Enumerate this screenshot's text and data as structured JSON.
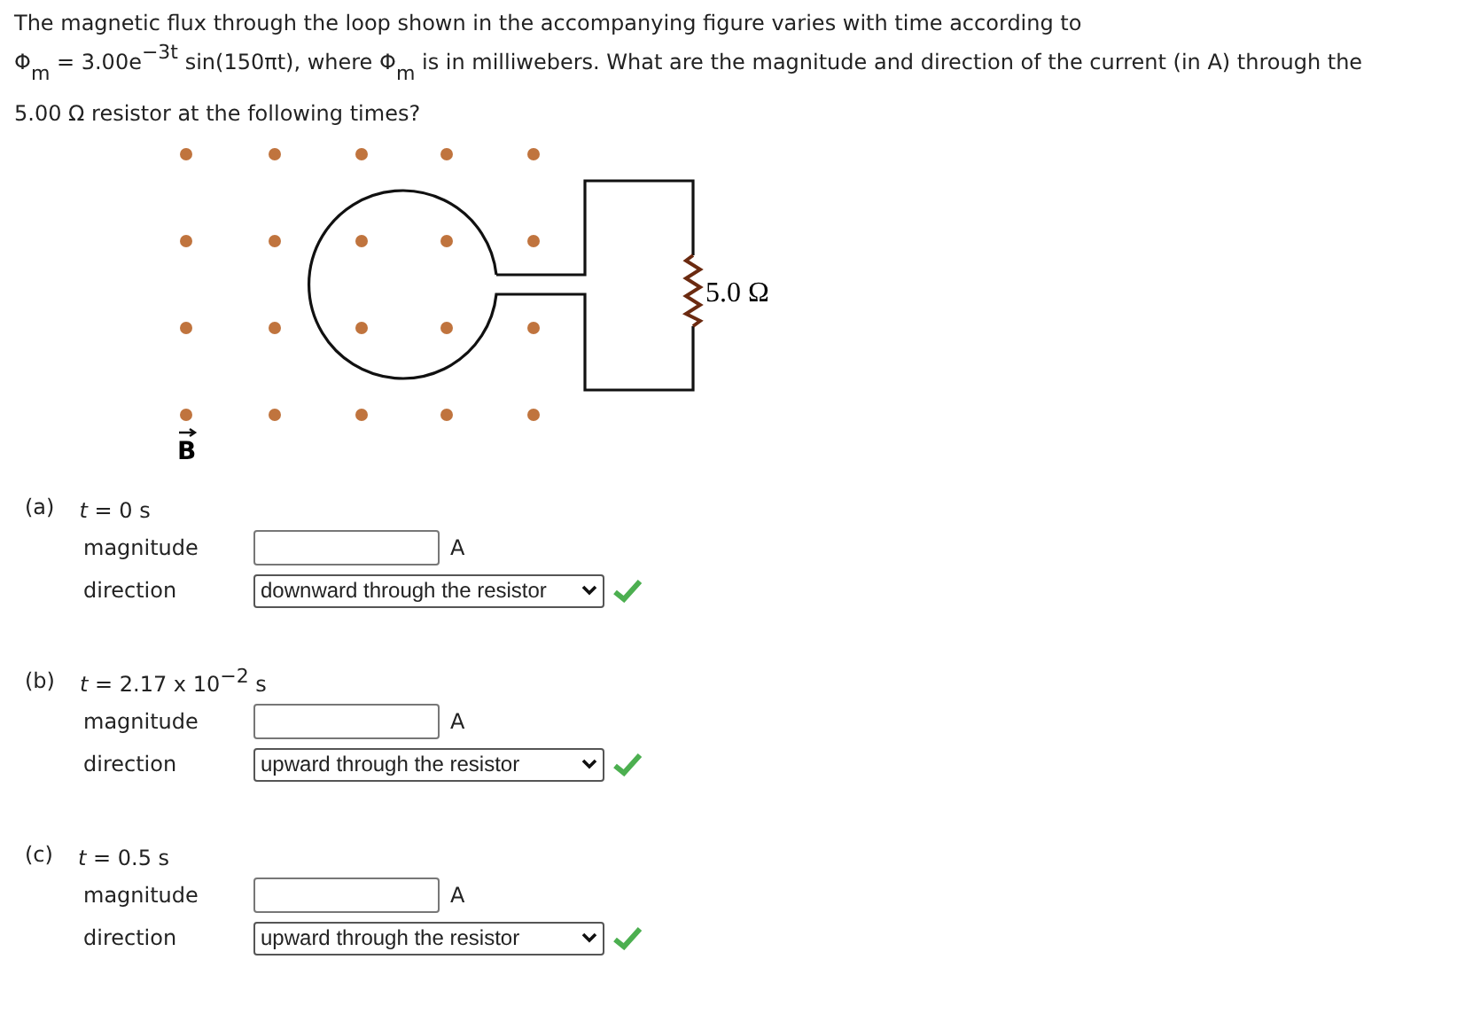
{
  "question": {
    "intro": "The magnetic flux through the loop shown in the accompanying figure varies with time according to",
    "formula_sentence": "Φ$_{m}$ = 3.00e$^{−3t}$ sin(150πt), where Φ$_{m}$ is in milliwebers. What are the magnitude and direction of the current (in A) through the 5.00 Ω resistor at the following times?"
  },
  "figure": {
    "resistor_label": "5.0 Ω",
    "field_label": "B"
  },
  "parts": [
    {
      "label": "(a)",
      "time": "*t* = 0 s",
      "magnitude_label": "magnitude",
      "unit": "A",
      "direction_label": "direction",
      "direction_value": "downward through the resistor",
      "correct": true
    },
    {
      "label": "(b)",
      "time": "*t* = 2.17 x 10$^{−2}$ s",
      "magnitude_label": "magnitude",
      "unit": "A",
      "direction_label": "direction",
      "direction_value": "upward through the resistor",
      "correct": true
    },
    {
      "label": "(c)",
      "time": "*t* = 0.5 s",
      "magnitude_label": "magnitude",
      "unit": "A",
      "direction_label": "direction",
      "direction_value": "upward through the resistor",
      "correct": true
    }
  ]
}
